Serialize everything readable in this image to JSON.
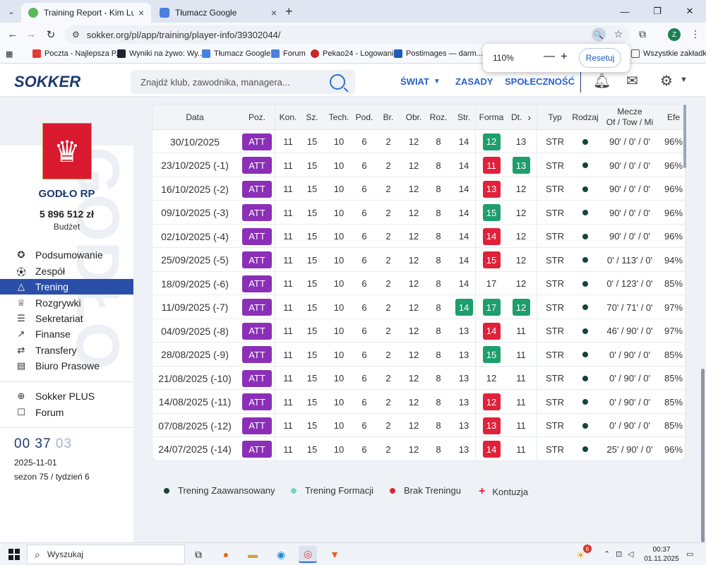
{
  "browser": {
    "tabs": [
      {
        "title": "Training Report - Kim Lumme -",
        "active": true
      },
      {
        "title": "Tłumacz Google",
        "active": false
      }
    ],
    "url": "sokker.org/pl/app/training/player-info/39302044/",
    "bookmarks": [
      {
        "label": "Poczta - Najlepsza P..."
      },
      {
        "label": "Wyniki na żywo: Wy..."
      },
      {
        "label": "Tłumacz Google"
      },
      {
        "label": "Forum"
      },
      {
        "label": "Pekao24 - Logowanie"
      },
      {
        "label": "Postimages — darm..."
      }
    ],
    "bookmarks_other": "Wszystkie zakładki",
    "profile_initial": "Z",
    "zoom": {
      "value": "110%",
      "minus": "—",
      "plus": "+",
      "reset_label": "Resetuj"
    }
  },
  "site": {
    "logo": "SOKKER",
    "search_placeholder": "Znajdź klub, zawodnika, managera...",
    "nav": [
      {
        "label": "ŚWIAT",
        "has_dropdown": true
      },
      {
        "label": "ZASADY",
        "has_dropdown": false
      },
      {
        "label": "SPOŁECZNOŚĆ",
        "has_dropdown": false
      }
    ],
    "header_icons": [
      "bell-icon",
      "mail-icon",
      "gear-icon"
    ]
  },
  "sidebar": {
    "club_name": "GODŁO RP",
    "budget": "5 896 512 zł",
    "budget_label": "Budżet",
    "watermark": "GODŁO",
    "menu": [
      {
        "label": "Podsumowanie",
        "icon": "summary-icon",
        "active": false
      },
      {
        "label": "Zespół",
        "icon": "ball-icon",
        "active": false
      },
      {
        "label": "Trening",
        "icon": "cone-icon",
        "active": true
      },
      {
        "label": "Rozgrywki",
        "icon": "trophy-icon",
        "active": false
      },
      {
        "label": "Sekretariat",
        "icon": "desk-icon",
        "active": false
      },
      {
        "label": "Finanse",
        "icon": "chart-icon",
        "active": false
      },
      {
        "label": "Transfery",
        "icon": "transfer-icon",
        "active": false
      },
      {
        "label": "Biuro Prasowe",
        "icon": "newspaper-icon",
        "active": false
      }
    ],
    "extra": [
      {
        "label": "Sokker PLUS",
        "icon": "plus-circle-icon"
      },
      {
        "label": "Forum",
        "icon": "chat-icon"
      }
    ],
    "clock": {
      "h": "00",
      "m": "37",
      "s": "03"
    },
    "date": "2025-11-01",
    "season": "sezon 75 / tydzień 6"
  },
  "table": {
    "headers": {
      "date": "Data",
      "pos": "Poz.",
      "kon": "Kon.",
      "sz": "Sz.",
      "tech": "Tech.",
      "pod": "Pod.",
      "br": "Br.",
      "obr": "Obr.",
      "roz": "Roz.",
      "str": "Str.",
      "forma": "Forma",
      "dt": "Dt.",
      "typ": "Typ",
      "rodzaj": "Rodzaj",
      "mecze1": "Mecze",
      "mecze2": "Of / Tow / Mi",
      "efe": "Efe"
    },
    "rows": [
      {
        "date": "30/10/2025",
        "pos": "ATT",
        "kon": "11",
        "sz": "15",
        "tech": "10",
        "pod": "6",
        "br": "2",
        "obr": "12",
        "roz": "8",
        "str": {
          "v": "14",
          "c": "none"
        },
        "forma": {
          "v": "12",
          "c": "green"
        },
        "dt": {
          "v": "13",
          "c": "none"
        },
        "typ": "STR",
        "mecze": "90' / 0' / 0'",
        "efe": "96%"
      },
      {
        "date": "23/10/2025 (-1)",
        "pos": "ATT",
        "kon": "11",
        "sz": "15",
        "tech": "10",
        "pod": "6",
        "br": "2",
        "obr": "12",
        "roz": "8",
        "str": {
          "v": "14",
          "c": "none"
        },
        "forma": {
          "v": "11",
          "c": "red"
        },
        "dt": {
          "v": "13",
          "c": "green"
        },
        "typ": "STR",
        "mecze": "90' / 0' / 0'",
        "efe": "96%"
      },
      {
        "date": "16/10/2025 (-2)",
        "pos": "ATT",
        "kon": "11",
        "sz": "15",
        "tech": "10",
        "pod": "6",
        "br": "2",
        "obr": "12",
        "roz": "8",
        "str": {
          "v": "14",
          "c": "none"
        },
        "forma": {
          "v": "13",
          "c": "red"
        },
        "dt": {
          "v": "12",
          "c": "none"
        },
        "typ": "STR",
        "mecze": "90' / 0' / 0'",
        "efe": "96%"
      },
      {
        "date": "09/10/2025 (-3)",
        "pos": "ATT",
        "kon": "11",
        "sz": "15",
        "tech": "10",
        "pod": "6",
        "br": "2",
        "obr": "12",
        "roz": "8",
        "str": {
          "v": "14",
          "c": "none"
        },
        "forma": {
          "v": "15",
          "c": "green"
        },
        "dt": {
          "v": "12",
          "c": "none"
        },
        "typ": "STR",
        "mecze": "90' / 0' / 0'",
        "efe": "96%"
      },
      {
        "date": "02/10/2025 (-4)",
        "pos": "ATT",
        "kon": "11",
        "sz": "15",
        "tech": "10",
        "pod": "6",
        "br": "2",
        "obr": "12",
        "roz": "8",
        "str": {
          "v": "14",
          "c": "none"
        },
        "forma": {
          "v": "14",
          "c": "red"
        },
        "dt": {
          "v": "12",
          "c": "none"
        },
        "typ": "STR",
        "mecze": "90' / 0' / 0'",
        "efe": "96%"
      },
      {
        "date": "25/09/2025 (-5)",
        "pos": "ATT",
        "kon": "11",
        "sz": "15",
        "tech": "10",
        "pod": "6",
        "br": "2",
        "obr": "12",
        "roz": "8",
        "str": {
          "v": "14",
          "c": "none"
        },
        "forma": {
          "v": "15",
          "c": "red"
        },
        "dt": {
          "v": "12",
          "c": "none"
        },
        "typ": "STR",
        "mecze": "0' / 113' / 0'",
        "efe": "94%"
      },
      {
        "date": "18/09/2025 (-6)",
        "pos": "ATT",
        "kon": "11",
        "sz": "15",
        "tech": "10",
        "pod": "6",
        "br": "2",
        "obr": "12",
        "roz": "8",
        "str": {
          "v": "14",
          "c": "none"
        },
        "forma": {
          "v": "17",
          "c": "none"
        },
        "dt": {
          "v": "12",
          "c": "none"
        },
        "typ": "STR",
        "mecze": "0' / 123' / 0'",
        "efe": "85%"
      },
      {
        "date": "11/09/2025 (-7)",
        "pos": "ATT",
        "kon": "11",
        "sz": "15",
        "tech": "10",
        "pod": "6",
        "br": "2",
        "obr": "12",
        "roz": "8",
        "str": {
          "v": "14",
          "c": "green"
        },
        "forma": {
          "v": "17",
          "c": "green"
        },
        "dt": {
          "v": "12",
          "c": "green"
        },
        "typ": "STR",
        "mecze": "70' / 71' / 0'",
        "efe": "97%"
      },
      {
        "date": "04/09/2025 (-8)",
        "pos": "ATT",
        "kon": "11",
        "sz": "15",
        "tech": "10",
        "pod": "6",
        "br": "2",
        "obr": "12",
        "roz": "8",
        "str": {
          "v": "13",
          "c": "none"
        },
        "forma": {
          "v": "14",
          "c": "red"
        },
        "dt": {
          "v": "11",
          "c": "none"
        },
        "typ": "STR",
        "mecze": "46' / 90' / 0'",
        "efe": "97%"
      },
      {
        "date": "28/08/2025 (-9)",
        "pos": "ATT",
        "kon": "11",
        "sz": "15",
        "tech": "10",
        "pod": "6",
        "br": "2",
        "obr": "12",
        "roz": "8",
        "str": {
          "v": "13",
          "c": "none"
        },
        "forma": {
          "v": "15",
          "c": "green"
        },
        "dt": {
          "v": "11",
          "c": "none"
        },
        "typ": "STR",
        "mecze": "0' / 90' / 0'",
        "efe": "85%"
      },
      {
        "date": "21/08/2025 (-10)",
        "pos": "ATT",
        "kon": "11",
        "sz": "15",
        "tech": "10",
        "pod": "6",
        "br": "2",
        "obr": "12",
        "roz": "8",
        "str": {
          "v": "13",
          "c": "none"
        },
        "forma": {
          "v": "12",
          "c": "none"
        },
        "dt": {
          "v": "11",
          "c": "none"
        },
        "typ": "STR",
        "mecze": "0' / 90' / 0'",
        "efe": "85%"
      },
      {
        "date": "14/08/2025 (-11)",
        "pos": "ATT",
        "kon": "11",
        "sz": "15",
        "tech": "10",
        "pod": "6",
        "br": "2",
        "obr": "12",
        "roz": "8",
        "str": {
          "v": "13",
          "c": "none"
        },
        "forma": {
          "v": "12",
          "c": "red"
        },
        "dt": {
          "v": "11",
          "c": "none"
        },
        "typ": "STR",
        "mecze": "0' / 90' / 0'",
        "efe": "85%"
      },
      {
        "date": "07/08/2025 (-12)",
        "pos": "ATT",
        "kon": "11",
        "sz": "15",
        "tech": "10",
        "pod": "6",
        "br": "2",
        "obr": "12",
        "roz": "8",
        "str": {
          "v": "13",
          "c": "none"
        },
        "forma": {
          "v": "13",
          "c": "red"
        },
        "dt": {
          "v": "11",
          "c": "none"
        },
        "typ": "STR",
        "mecze": "0' / 90' / 0'",
        "efe": "85%"
      },
      {
        "date": "24/07/2025 (-14)",
        "pos": "ATT",
        "kon": "11",
        "sz": "15",
        "tech": "10",
        "pod": "6",
        "br": "2",
        "obr": "12",
        "roz": "8",
        "str": {
          "v": "13",
          "c": "none"
        },
        "forma": {
          "v": "14",
          "c": "red"
        },
        "dt": {
          "v": "11",
          "c": "none"
        },
        "typ": "STR",
        "mecze": "25' / 90' / 0'",
        "efe": "96%"
      }
    ]
  },
  "legend": [
    {
      "label": "Trening Zaawansowany",
      "color": "#17423e",
      "kind": "dot"
    },
    {
      "label": "Trening Formacji",
      "color": "#7fd4b4",
      "kind": "dot"
    },
    {
      "label": "Brak Treningu",
      "color": "#d9262e",
      "kind": "dot"
    },
    {
      "label": "Kontuzja",
      "color": "#e0213a",
      "kind": "plus"
    }
  ],
  "colors": {
    "accent": "#2b4fa9",
    "pos_badge": "#8b2fb8",
    "good": "#1e9e6c",
    "bad": "#e0213a"
  },
  "taskbar": {
    "search_placeholder": "Wyszukaj",
    "notification_count": "6",
    "time": "00:37",
    "date": "01.11.2025"
  }
}
